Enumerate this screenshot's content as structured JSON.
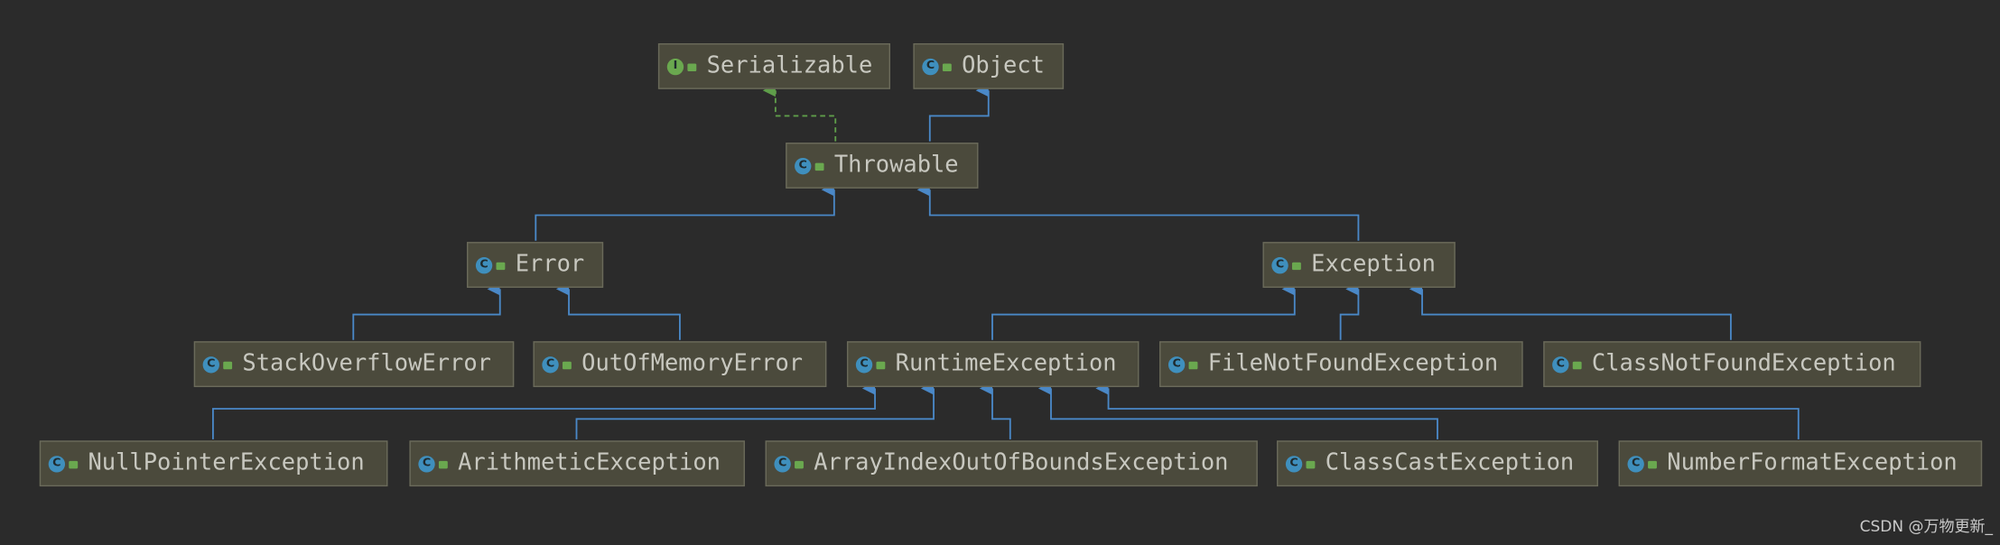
{
  "nodes": {
    "serializable": {
      "label": "Serializable",
      "kind": "interface",
      "icon": "interface-icon"
    },
    "object": {
      "label": "Object",
      "kind": "class",
      "icon": "class-icon"
    },
    "throwable": {
      "label": "Throwable",
      "kind": "class",
      "icon": "class-icon"
    },
    "error": {
      "label": "Error",
      "kind": "class",
      "icon": "class-icon"
    },
    "exception": {
      "label": "Exception",
      "kind": "class",
      "icon": "class-icon"
    },
    "stackoverflow": {
      "label": "StackOverflowError",
      "kind": "class",
      "icon": "class-icon"
    },
    "outofmemory": {
      "label": "OutOfMemoryError",
      "kind": "class",
      "icon": "class-icon"
    },
    "runtime": {
      "label": "RuntimeException",
      "kind": "class",
      "icon": "class-icon"
    },
    "filenotfound": {
      "label": "FileNotFoundException",
      "kind": "class",
      "icon": "class-icon"
    },
    "classnotfound": {
      "label": "ClassNotFoundException",
      "kind": "class",
      "icon": "class-icon"
    },
    "nullpointer": {
      "label": "NullPointerException",
      "kind": "class",
      "icon": "class-icon"
    },
    "arithmetic": {
      "label": "ArithmeticException",
      "kind": "class",
      "icon": "class-icon"
    },
    "arrayindex": {
      "label": "ArrayIndexOutOfBoundsException",
      "kind": "class",
      "icon": "class-icon"
    },
    "classcast": {
      "label": "ClassCastException",
      "kind": "class",
      "icon": "class-icon"
    },
    "numberformat": {
      "label": "NumberFormatException",
      "kind": "class",
      "icon": "class-icon"
    }
  },
  "edges": [
    {
      "from": "throwable",
      "to": "serializable",
      "type": "implements"
    },
    {
      "from": "throwable",
      "to": "object",
      "type": "extends"
    },
    {
      "from": "error",
      "to": "throwable",
      "type": "extends"
    },
    {
      "from": "exception",
      "to": "throwable",
      "type": "extends"
    },
    {
      "from": "stackoverflow",
      "to": "error",
      "type": "extends"
    },
    {
      "from": "outofmemory",
      "to": "error",
      "type": "extends"
    },
    {
      "from": "runtime",
      "to": "exception",
      "type": "extends"
    },
    {
      "from": "filenotfound",
      "to": "exception",
      "type": "extends"
    },
    {
      "from": "classnotfound",
      "to": "exception",
      "type": "extends"
    },
    {
      "from": "nullpointer",
      "to": "runtime",
      "type": "extends"
    },
    {
      "from": "arithmetic",
      "to": "runtime",
      "type": "extends"
    },
    {
      "from": "arrayindex",
      "to": "runtime",
      "type": "extends"
    },
    {
      "from": "classcast",
      "to": "runtime",
      "type": "extends"
    },
    {
      "from": "numberformat",
      "to": "runtime",
      "type": "extends"
    }
  ],
  "colors": {
    "background": "#2b2b2b",
    "node_fill": "#4b4a3c",
    "extends_edge": "#4a88c7",
    "implements_edge": "#5f9e4a",
    "class_icon": "#3f8fbd",
    "interface_icon": "#6aa84f"
  },
  "watermark": "CSDN @万物更新_"
}
